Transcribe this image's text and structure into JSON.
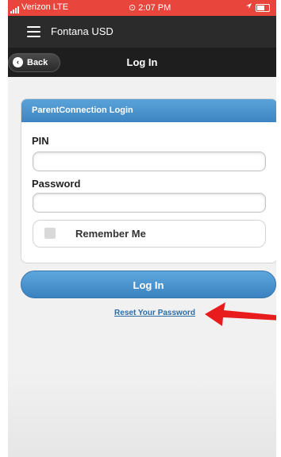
{
  "status_bar": {
    "carrier": "Verizon  LTE",
    "time": "⊙ 2:07 PM"
  },
  "app_header": {
    "title": "Fontana USD"
  },
  "nav_bar": {
    "back_label": "Back",
    "title": "Log In"
  },
  "login_card": {
    "header": "ParentConnection Login",
    "pin_label": "PIN",
    "pin_value": "",
    "password_label": "Password",
    "password_value": "",
    "remember_label": "Remember Me",
    "remember_checked": false
  },
  "actions": {
    "login_label": "Log In",
    "reset_label": "Reset Your Password"
  },
  "colors": {
    "status_bar": "#e8453c",
    "header": "#2b2b2b",
    "accent_blue": "#4a94cf",
    "annotation_arrow": "#e81c1c"
  }
}
